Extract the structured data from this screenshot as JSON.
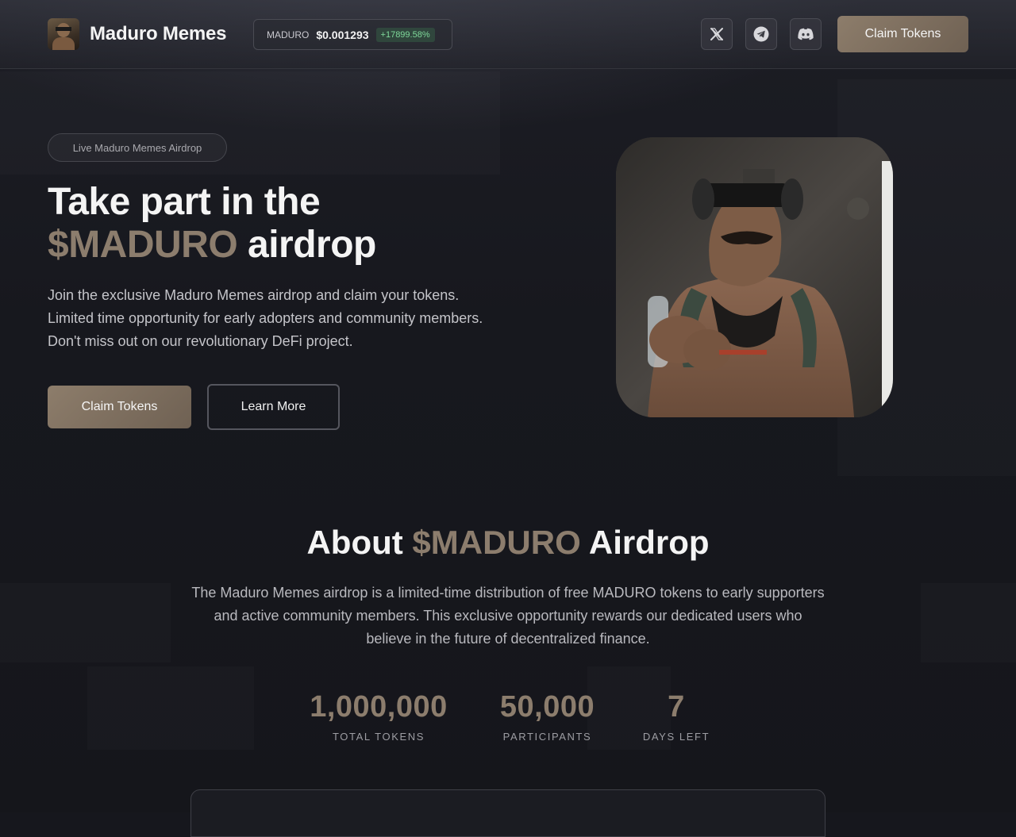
{
  "header": {
    "brand_name": "Maduro Memes",
    "ticker": {
      "symbol": "MADURO",
      "price": "$0.001293",
      "change": "+17899.58%"
    },
    "social": [
      "x-icon",
      "telegram-icon",
      "discord-icon"
    ],
    "claim_label": "Claim Tokens"
  },
  "hero": {
    "badge": "Live Maduro Memes Airdrop",
    "title_line1": "Take part in the",
    "title_accent": "$MADURO",
    "title_line2_rest": " airdrop",
    "description": "Join the exclusive Maduro Memes airdrop and claim your tokens. Limited time opportunity for early adopters and community members. Don't miss out on our revolutionary DeFi project.",
    "claim_label": "Claim Tokens",
    "learn_label": "Learn More"
  },
  "about": {
    "title_prefix": "About ",
    "title_accent": "$MADURO",
    "title_suffix": " Airdrop",
    "description": "The Maduro Memes airdrop is a limited-time distribution of free MADURO tokens to early supporters and active community members. This exclusive opportunity rewards our dedicated users who believe in the future of decentralized finance.",
    "stats": [
      {
        "value": "1,000,000",
        "label": "TOTAL TOKENS"
      },
      {
        "value": "50,000",
        "label": "PARTICIPANTS"
      },
      {
        "value": "7",
        "label": "DAYS LEFT"
      }
    ]
  },
  "colors": {
    "accent": "#8c7d6d",
    "background": "#16171d",
    "positive": "#7fd99a"
  }
}
